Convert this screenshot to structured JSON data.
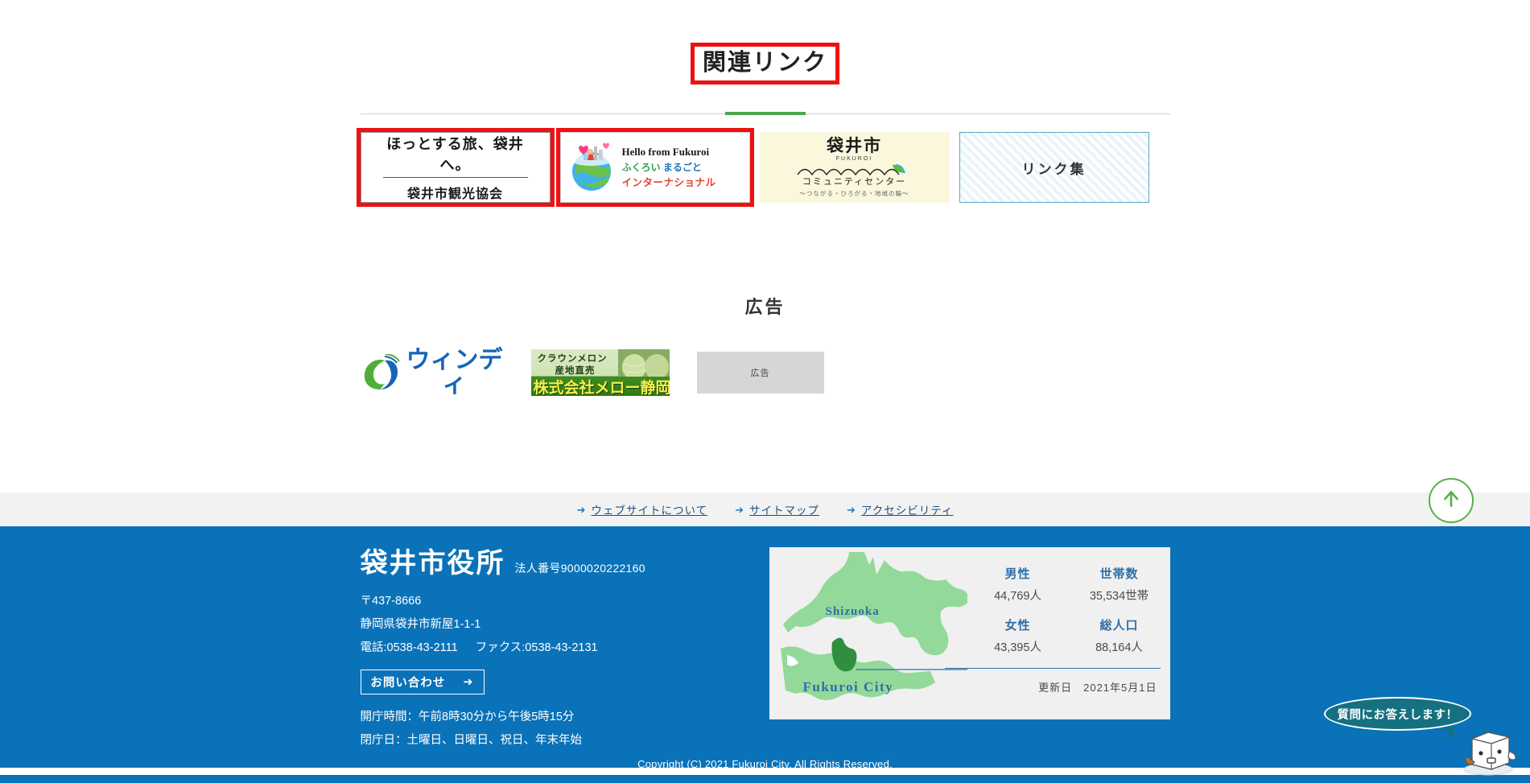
{
  "related": {
    "title": "関連リンク",
    "banners": [
      {
        "name": "tourism-association",
        "line1": "ほっとする旅、袋井へ。",
        "line2": "袋井市観光協会",
        "highlighted": true
      },
      {
        "name": "hello-from-fukuroi",
        "line1": "Hello from Fukuroi",
        "line2a": "ふくろい",
        "line2b": "まるごと",
        "line3": "インターナショナル",
        "icon": "globe-icon",
        "highlighted": true
      },
      {
        "name": "community-center",
        "title": "袋井市",
        "roman": "FUKUROI",
        "sub": "コミュニティセンター",
        "tagline": "〜つながる・ひろがる・地域の輪〜",
        "highlighted": false
      },
      {
        "name": "link-collection",
        "label": "リンク集",
        "highlighted": false
      }
    ]
  },
  "ads": {
    "title": "広告",
    "items": [
      {
        "name": "windy",
        "text": "ウィンディ",
        "icon": "windy-swirl-icon"
      },
      {
        "name": "mellow-shizuoka",
        "line1": "クラウンメロン",
        "line2": "産地直売",
        "line3": "株式会社メロー静岡"
      },
      {
        "name": "ad-placeholder",
        "label": "広告"
      }
    ]
  },
  "utility_links": [
    {
      "label": "ウェブサイトについて",
      "icon": "arrow-right-icon"
    },
    {
      "label": "サイトマップ",
      "icon": "arrow-right-icon"
    },
    {
      "label": "アクセシビリティ",
      "icon": "arrow-right-icon"
    }
  ],
  "footer": {
    "org": "袋井市役所",
    "corporate_number": "法人番号9000020222160",
    "postal": "〒437-8666",
    "address": "静岡県袋井市新屋1-1-1",
    "tel": "電話:0538-43-2111",
    "fax": "ファクス:0538-43-2131",
    "contact_button": "お問い合わせ",
    "contact_button_icon": "arrow-right-icon",
    "hours": "開庁時間：午前8時30分から午後5時15分",
    "closed": "閉庁日：土曜日、日曜日、祝日、年末年始",
    "map": {
      "prefecture_label": "Shizuoka",
      "city_label": "Fukuroi City"
    },
    "stats": [
      {
        "label": "男性",
        "value": "44,769人"
      },
      {
        "label": "世帯数",
        "value": "35,534世帯"
      },
      {
        "label": "女性",
        "value": "43,395人"
      },
      {
        "label": "総人口",
        "value": "88,164人"
      }
    ],
    "updated": "更新日　2021年5月1日",
    "copyright": "Copyright (C) 2021 Fukuroi City. All Rights Reserved."
  },
  "widgets": {
    "back_to_top_icon": "arrow-up-icon",
    "chat_bubble": "質問にお答えします！",
    "chat_mascot_icon": "cube-mascot-icon"
  },
  "colors": {
    "footer_blue": "#0a72b8",
    "accent_green": "#4ca64c",
    "highlight_red": "#ee1111",
    "link_blue": "#2f6fa8"
  }
}
